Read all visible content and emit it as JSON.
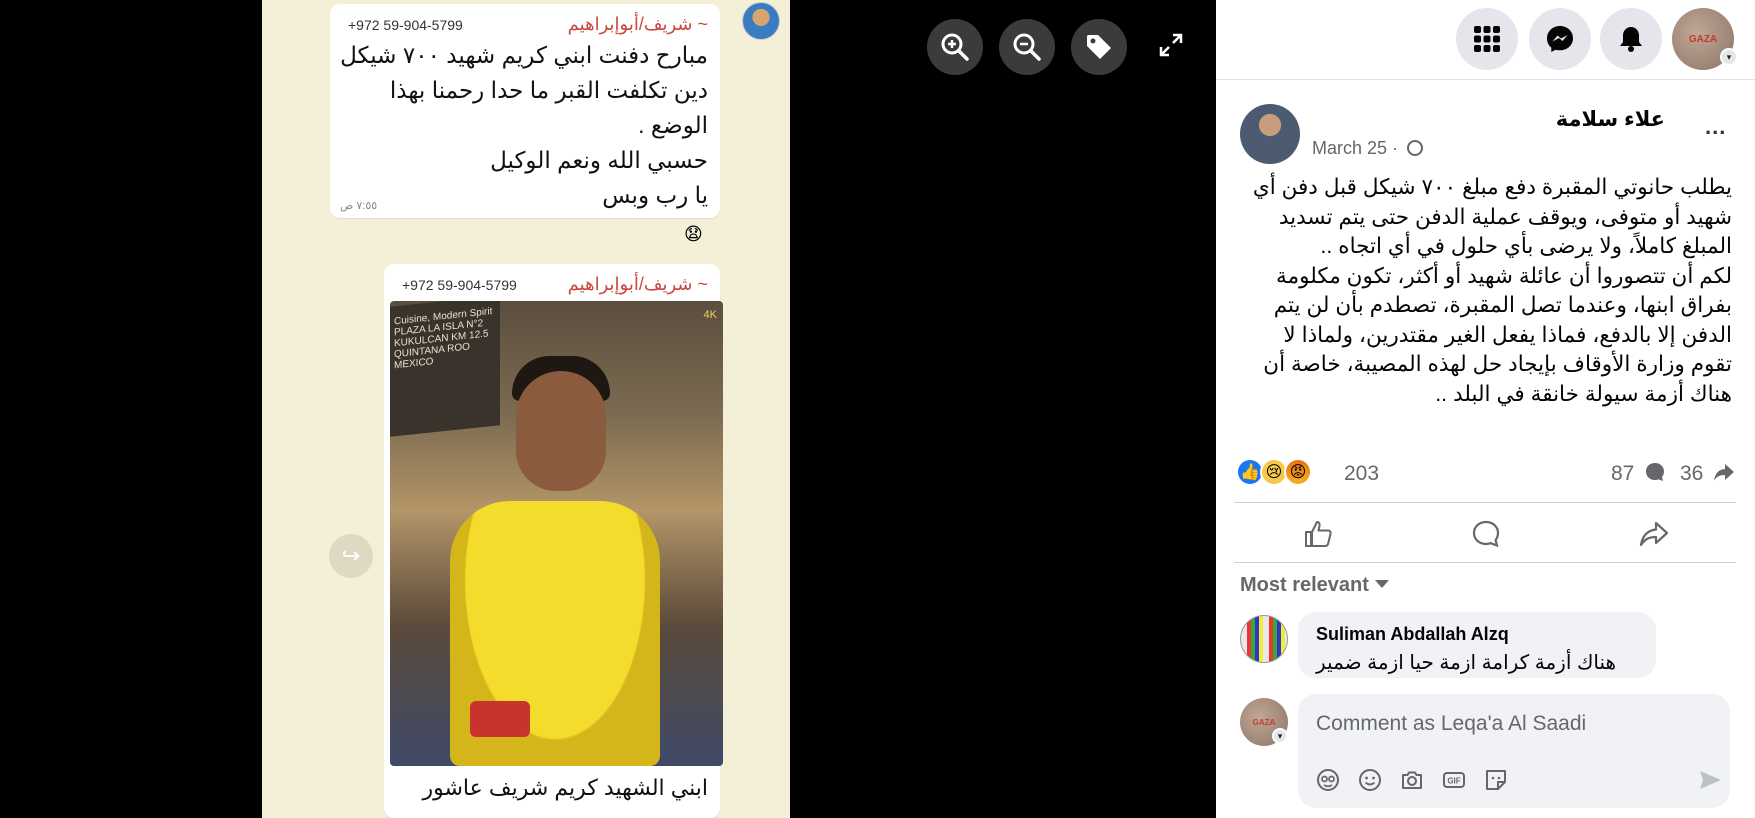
{
  "chat": {
    "message1": {
      "sender": "~ شريف/أبوإبراهيم",
      "phone": "+972 59-904-5799",
      "lines": [
        "مبارح دفنت ابني كريم شهيد ٧٠٠ شيكل",
        "دين تكلفت القبر ما حدا رحمنا بهذا",
        "الوضع .",
        "حسبي الله ونعم الوكيل",
        "يا رب وبس"
      ],
      "time": "٧:٥٥ ص",
      "reaction_emoji": "😧"
    },
    "message2": {
      "sender": "~ شريف/أبوإبراهيم",
      "phone": "+972 59-904-5799",
      "caption": "ابني الشهيد كريم شريف عاشور",
      "poster_text": "Cuisine, Modern Spirit PLAZA LA ISLA N°2 KUKULCAN KM 12.5 QUINTANA ROO MEXICO",
      "logo_text": "4K"
    },
    "forward_icon": "↪"
  },
  "viewer": {
    "zoom_in_icon": "zoom-in",
    "zoom_out_icon": "zoom-out",
    "tag_icon": "tag",
    "fullscreen_icon": "fullscreen"
  },
  "topbar": {
    "menu_icon": "grid-menu",
    "messenger_icon": "messenger",
    "notifications_icon": "bell",
    "profile_badge": "GAZA"
  },
  "post": {
    "author": "علاء سلامة",
    "more": "...",
    "date": "March 25 ·",
    "paragraph1": "يطلب حانوتي المقبرة دفع مبلغ ٧٠٠ شيكل قبل دفن أي شهيد أو متوفى، ويوقف عملية الدفن حتى يتم تسديد المبلغ كاملاً، ولا يرضى بأي حلول في أي اتجاه ..",
    "paragraph2": "لكم أن تتصوروا أن عائلة شهيد أو أكثر، تكون مكلومة بفراق ابنها، وعندما تصل المقبرة، تصطدم بأن لن يتم الدفن إلا بالدفع، فماذا يفعل الغير مقتدرين، ولماذا لا تقوم وزارة الأوقاف بإيجاد حل لهذه المصيبة، خاصة أن هناك أزمة سيولة خانقة في البلد ..",
    "reaction_count": "203",
    "comment_count": "87",
    "share_count": "36"
  },
  "comments": {
    "sort_label": "Most relevant",
    "items": [
      {
        "author": "Suliman Abdallah Alzq",
        "text": "هناك أزمة كرامة ازمة حيا ازمة ضمير"
      }
    ],
    "input_placeholder": "Comment as Leqa'a Al Saadi",
    "self_badge": "GAZA"
  },
  "colors": {
    "accent": "#1877f2",
    "chat_background": "#f4f0d8",
    "sender_name": "#c9473d"
  }
}
